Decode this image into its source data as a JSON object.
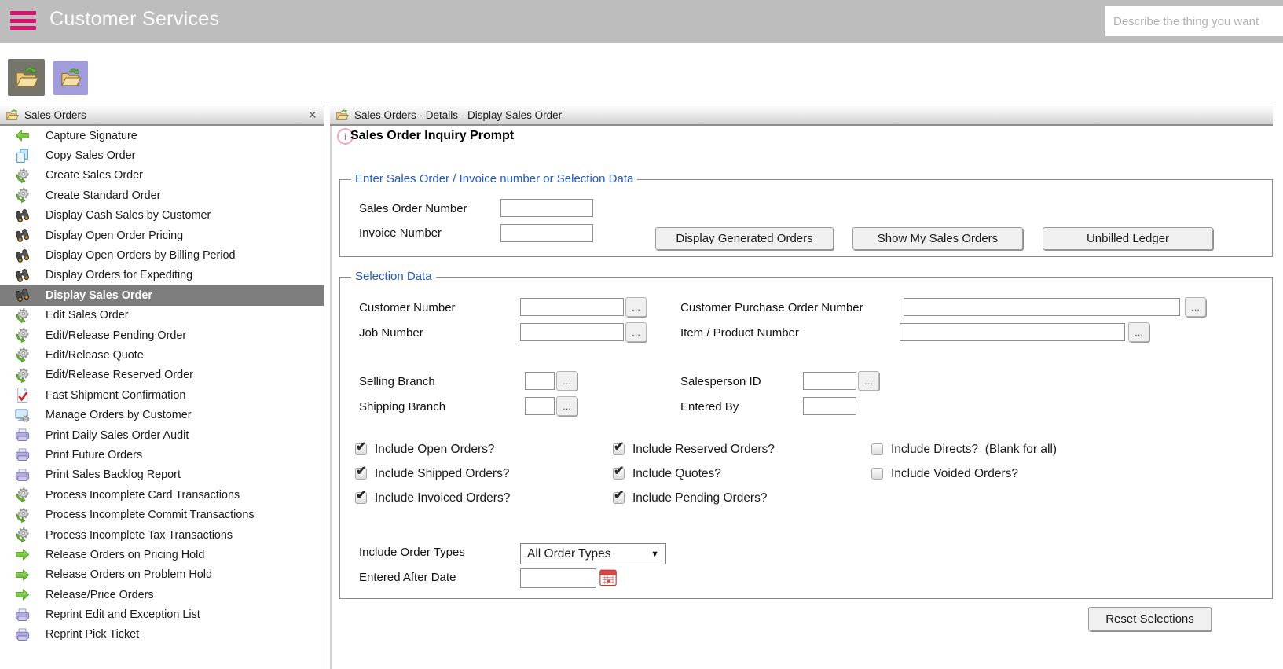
{
  "topbar": {
    "title": "Customer Services",
    "menu_icon": "hamburger-menu-icon",
    "accent_color": "#d5156e",
    "bar_color": "#bdbdbd",
    "search": {
      "placeholder": "Describe the thing you want",
      "value": ""
    }
  },
  "toolbar": {
    "buttons": [
      {
        "name": "open-folder-active",
        "icon": "folder-icon",
        "selected": true
      },
      {
        "name": "open-folder",
        "icon": "folder-icon",
        "selected": false
      }
    ]
  },
  "sidebar": {
    "header": {
      "icon": "folder-icon",
      "title": "Sales Orders",
      "close_icon": "×"
    },
    "selected_item": "Display Sales Order",
    "items": [
      {
        "label": "Capture Signature",
        "icon": "arrow-left-icon",
        "selected": false
      },
      {
        "label": "Copy Sales Order",
        "icon": "copy-icon",
        "selected": false
      },
      {
        "label": "Create Sales Order",
        "icon": "gear-icon",
        "selected": false
      },
      {
        "label": "Create Standard Order",
        "icon": "gear-icon",
        "selected": false
      },
      {
        "label": "Display Cash Sales by Customer",
        "icon": "binoculars-icon",
        "selected": false
      },
      {
        "label": "Display Open Order Pricing",
        "icon": "binoculars-icon",
        "selected": false
      },
      {
        "label": "Display Open Orders by Billing Period",
        "icon": "binoculars-icon",
        "selected": false
      },
      {
        "label": "Display Orders for Expediting",
        "icon": "binoculars-icon",
        "selected": false
      },
      {
        "label": "Display Sales Order",
        "icon": "binoculars-icon",
        "selected": true
      },
      {
        "label": "Edit Sales Order",
        "icon": "gear-icon",
        "selected": false
      },
      {
        "label": "Edit/Release Pending Order",
        "icon": "gear-icon",
        "selected": false
      },
      {
        "label": "Edit/Release Quote",
        "icon": "gear-icon",
        "selected": false
      },
      {
        "label": "Edit/Release Reserved Order",
        "icon": "gear-icon",
        "selected": false
      },
      {
        "label": "Fast Shipment Confirmation",
        "icon": "doc-check-icon",
        "selected": false
      },
      {
        "label": "Manage Orders by Customer",
        "icon": "monitor-gear-icon",
        "selected": false
      },
      {
        "label": "Print Daily Sales Order Audit",
        "icon": "printer-icon",
        "selected": false
      },
      {
        "label": "Print Future Orders",
        "icon": "printer-icon",
        "selected": false
      },
      {
        "label": "Print Sales Backlog Report",
        "icon": "printer-icon",
        "selected": false
      },
      {
        "label": "Process Incomplete Card Transactions",
        "icon": "gear-icon",
        "selected": false
      },
      {
        "label": "Process Incomplete Commit Transactions",
        "icon": "gear-icon",
        "selected": false
      },
      {
        "label": "Process Incomplete Tax Transactions",
        "icon": "gear-icon",
        "selected": false
      },
      {
        "label": "Release Orders on Pricing Hold",
        "icon": "arrow-right-icon",
        "selected": false
      },
      {
        "label": "Release Orders on Problem Hold",
        "icon": "arrow-right-icon",
        "selected": false
      },
      {
        "label": "Release/Price Orders",
        "icon": "arrow-right-icon",
        "selected": false
      },
      {
        "label": "Reprint Edit and Exception List",
        "icon": "printer-icon",
        "selected": false
      },
      {
        "label": "Reprint Pick Ticket",
        "icon": "printer-icon",
        "selected": false
      }
    ]
  },
  "main": {
    "header": {
      "icon": "folder-icon",
      "breadcrumb": "Sales Orders - Details - Display Sales Order"
    },
    "info_icon": "i",
    "page_title": "Sales Order Inquiry Prompt",
    "order_entry": {
      "legend": "Enter Sales Order / Invoice number or Selection Data",
      "fields": {
        "sales_order_number": {
          "label": "Sales Order Number",
          "value": ""
        },
        "invoice_number": {
          "label": "Invoice Number",
          "value": ""
        }
      },
      "buttons": {
        "display_generated_orders": "Display Generated Orders",
        "show_my_sales_orders": "Show My Sales Orders",
        "unbilled_ledger": "Unbilled Ledger"
      }
    },
    "selection": {
      "legend": "Selection Data",
      "browse_button": "...",
      "fields": {
        "customer_number": {
          "label": "Customer Number",
          "value": ""
        },
        "job_number": {
          "label": "Job Number",
          "value": ""
        },
        "customer_purchase_order_number": {
          "label": "Customer Purchase Order Number",
          "value": ""
        },
        "item_product_number": {
          "label": "Item / Product Number",
          "value": ""
        },
        "selling_branch": {
          "label": "Selling Branch",
          "value": ""
        },
        "shipping_branch": {
          "label": "Shipping Branch",
          "value": ""
        },
        "salesperson_id": {
          "label": "Salesperson ID",
          "value": ""
        },
        "entered_by": {
          "label": "Entered By",
          "value": ""
        },
        "include_order_types": {
          "label": "Include Order Types",
          "value": "All Order Types"
        },
        "entered_after_date": {
          "label": "Entered After Date",
          "value": ""
        }
      },
      "dropdown_arrow_icon": "▼",
      "calendar_icon": "calendar-icon",
      "checkbox_columns": [
        [
          {
            "label": "Include Open Orders?",
            "checked": true
          },
          {
            "label": "Include Shipped Orders?",
            "checked": true
          },
          {
            "label": "Include Invoiced Orders?",
            "checked": true
          }
        ],
        [
          {
            "label": "Include Reserved Orders?",
            "checked": true
          },
          {
            "label": "Include Quotes?",
            "checked": true
          },
          {
            "label": "Include Pending Orders?",
            "checked": true
          }
        ],
        [
          {
            "label": "Include Directs?  (Blank for all)",
            "checked": false
          },
          {
            "label": "Include Voided Orders?",
            "checked": false
          }
        ]
      ]
    },
    "reset_selections_button": "Reset Selections"
  }
}
